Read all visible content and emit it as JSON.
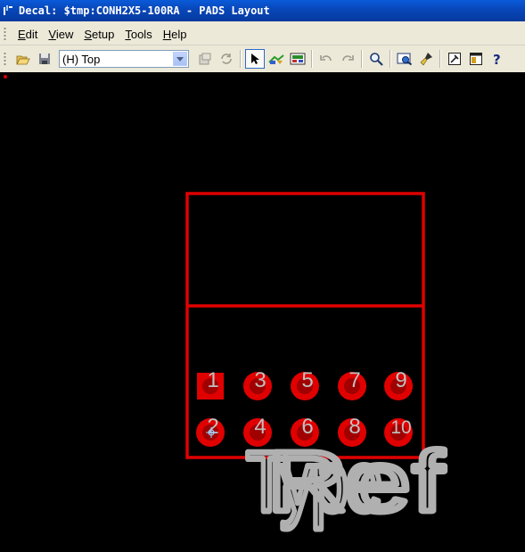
{
  "window": {
    "title": "Decal: $tmp:CONH2X5-100RA - PADS Layout"
  },
  "menu": {
    "items": [
      {
        "mnemonic": "E",
        "rest": "dit"
      },
      {
        "mnemonic": "V",
        "rest": "iew"
      },
      {
        "mnemonic": "S",
        "rest": "etup"
      },
      {
        "mnemonic": "T",
        "rest": "ools"
      },
      {
        "mnemonic": "H",
        "rest": "elp"
      }
    ]
  },
  "toolbar": {
    "layer_value": "(H) Top",
    "buttons": [
      "open-icon",
      "save-icon",
      "layer-props-icon",
      "refresh-icon",
      "select-pointer-icon",
      "route-icon",
      "board-icon",
      "undo-icon",
      "redo-icon",
      "zoom-icon",
      "view-icon",
      "paint-icon",
      "properties-icon",
      "window-icon",
      "help-icon"
    ]
  },
  "decal": {
    "pins": [
      {
        "label": "1",
        "shape": "square"
      },
      {
        "label": "2",
        "shape": "round"
      },
      {
        "label": "3",
        "shape": "round"
      },
      {
        "label": "4",
        "shape": "round"
      },
      {
        "label": "5",
        "shape": "round"
      },
      {
        "label": "6",
        "shape": "round"
      },
      {
        "label": "7",
        "shape": "round"
      },
      {
        "label": "8",
        "shape": "round"
      },
      {
        "label": "9",
        "shape": "round"
      },
      {
        "label": "10",
        "shape": "round"
      }
    ],
    "attribute_text": [
      "Type",
      "Ref"
    ],
    "colors": {
      "outline": "#e00000",
      "pad": "#e00000",
      "pin_number": "#c0c0c0",
      "attribute": "#b0b0b0",
      "background": "#000000"
    }
  }
}
